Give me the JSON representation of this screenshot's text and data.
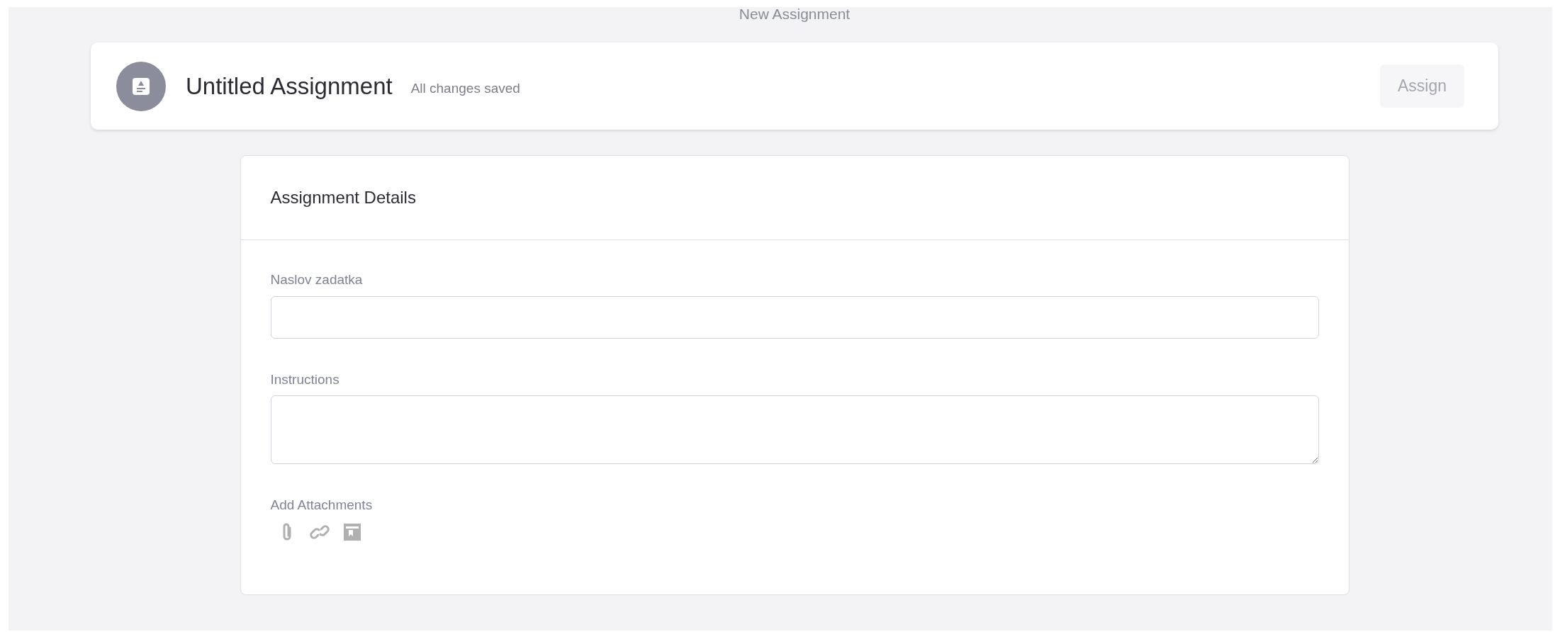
{
  "page_title": "New Assignment",
  "header": {
    "title": "Untitled Assignment",
    "save_status": "All changes saved",
    "assign_button": {
      "label": "Assign",
      "disabled": true
    }
  },
  "card": {
    "title": "Assignment Details",
    "fields": [
      {
        "kind": "input",
        "label": "Naslov zadatka"
      },
      {
        "kind": "textarea",
        "label": "Instructions"
      }
    ],
    "attachments": {
      "label": "Add Attachments",
      "tools": [
        {
          "kind": "paperclip"
        },
        {
          "kind": "link"
        },
        {
          "kind": "drive"
        }
      ]
    }
  }
}
